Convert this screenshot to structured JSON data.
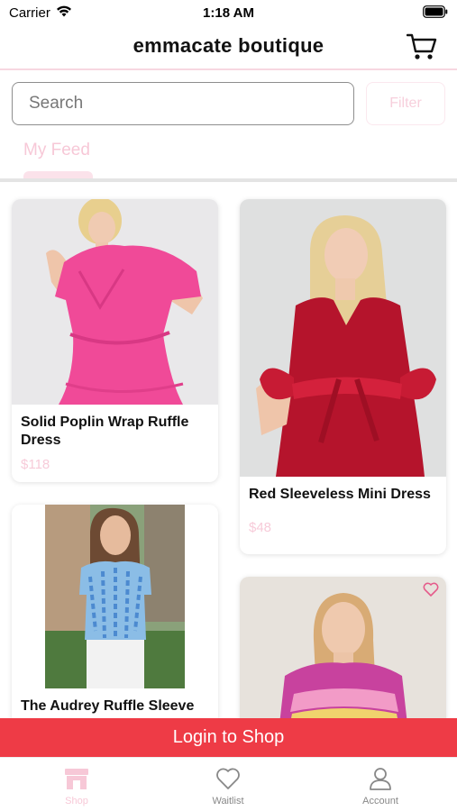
{
  "status_bar": {
    "carrier": "Carrier",
    "time": "1:18 AM"
  },
  "header": {
    "title": "emmacate boutique"
  },
  "search": {
    "placeholder": "Search",
    "filter_label": "Filter"
  },
  "tabs": {
    "my_feed": "My Feed"
  },
  "products": [
    {
      "name": "Solid Poplin Wrap Ruffle Dress",
      "price": "$118"
    },
    {
      "name": "Red Sleeveless Mini Dress",
      "price": "$48"
    },
    {
      "name": "The Audrey Ruffle Sleeve Top",
      "price": ""
    },
    {
      "name": "",
      "price": ""
    }
  ],
  "login_bar": {
    "label": "Login to Shop"
  },
  "tab_bar": {
    "shop": "Shop",
    "waitlist": "Waitlist",
    "account": "Account"
  },
  "colors": {
    "accent_pink": "#f7c8d7",
    "login_red": "#ee3b46",
    "heart_pink": "#e55a8a"
  }
}
